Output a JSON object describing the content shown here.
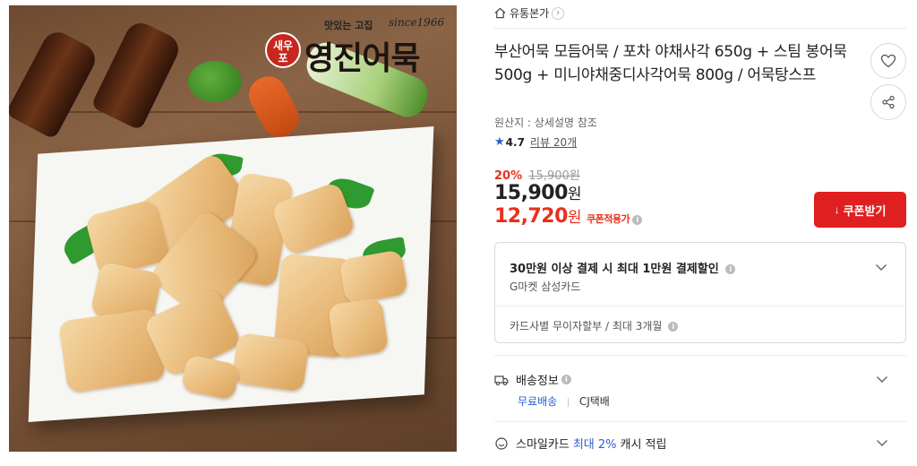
{
  "image": {
    "logo": {
      "badge": "새우\n포",
      "tagline": "맛있는 고집",
      "since": "since1966",
      "name": "영진어묵"
    }
  },
  "store": {
    "name": "유통본가",
    "icon": "home-icon"
  },
  "product": {
    "title": "부산어묵 모듬어묵 / 포차 야채사각 650g + 스팀 봉어묵 500g + 미니야채중디사각어묵 800g / 어묵탕스프",
    "origin": "원산지 : 상세설명 참조",
    "rating": "4.7",
    "review_link": "리뷰 20개"
  },
  "price": {
    "discount_rate": "20%",
    "original": "15,900원",
    "sale_amount": "15,900",
    "won": "원",
    "coupon_amount": "12,720",
    "coupon_label": "쿠폰적용가",
    "coupon_button": "쿠폰받기"
  },
  "card_benefit": {
    "title": "30만원 이상 결제 시 최대 1만원 결제할인",
    "card": "G마켓 삼성카드",
    "installment": "카드사별 무이자할부 / 최대 3개월"
  },
  "shipping": {
    "label": "배송정보",
    "free": "무료배송",
    "carrier": "CJ택배"
  },
  "smile": {
    "prefix": "스마일카드",
    "highlight": "최대 2%",
    "suffix": "캐시 적립"
  },
  "colors": {
    "accent_red": "#e02020",
    "discount_red": "#e8301c",
    "link_blue": "#2a5fcf"
  },
  "icons": [
    "home-icon",
    "heart-icon",
    "share-icon",
    "star-icon",
    "info-icon",
    "download-icon",
    "chevron-down-icon",
    "truck-icon",
    "smile-icon"
  ]
}
